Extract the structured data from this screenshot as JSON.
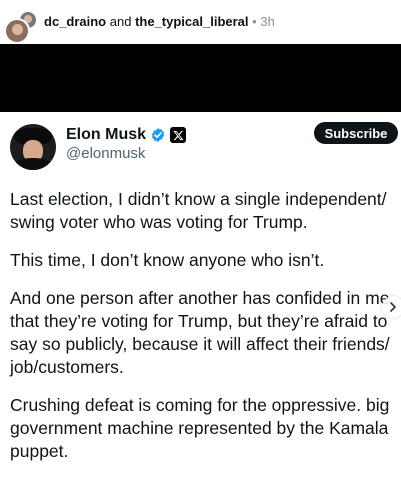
{
  "post_header": {
    "author1": "dc_draino",
    "joiner": "and",
    "author2": "the_typical_liberal",
    "separator": "•",
    "time": "3h"
  },
  "tweet": {
    "display_name": "Elon Musk",
    "handle": "@elonmusk",
    "subscribe_label": "Subscribe",
    "verified_color": "#1d9bf0",
    "paragraphs": [
      "Last election, I didn’t know a single independent/ swing voter who was voting for Trump.",
      "This time, I don’t know anyone who isn’t.",
      "And one person after another has confided in me that they’re voting for Trump, but they’re afraid to say so publicly, because it will affect their friends/ job/customers.",
      "Crushing defeat is coming for the oppressive. big government machine represented by the Kamala puppet."
    ]
  },
  "icons": {
    "verified": "verified-badge-icon",
    "x_logo": "x-logo-icon",
    "next": "chevron-right-icon"
  }
}
